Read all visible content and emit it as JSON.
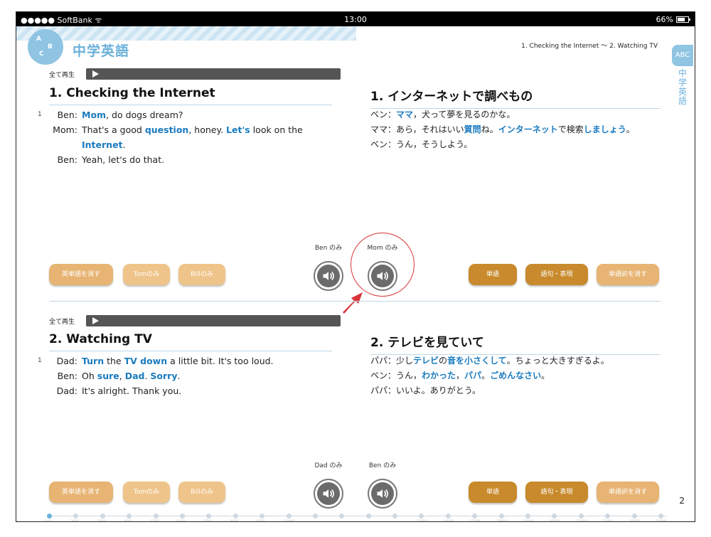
{
  "status_bar": {
    "carrier": "●●●●● SoftBank ᯤ",
    "time": "13:00",
    "battery": "66%"
  },
  "header": {
    "logo_letters": [
      "A",
      "B",
      "C"
    ],
    "title": "中学英語",
    "breadcrumb": "1. Checking the Internet ～ 2. Watching TV"
  },
  "side_tab": {
    "badge": "ABC",
    "label": "中学英語"
  },
  "playall_label": "全て再生",
  "sections": [
    {
      "en_title": "1. Checking the Internet",
      "jp_title": "1. インターネットで調べもの",
      "line_number": "1",
      "en_lines": [
        {
          "speaker": "Ben:",
          "parts": [
            {
              "t": "Mom",
              "h": true
            },
            {
              "t": ", do dogs dream?",
              "h": false
            }
          ]
        },
        {
          "speaker": "Mom:",
          "parts": [
            {
              "t": "That's a good ",
              "h": false
            },
            {
              "t": "question",
              "h": true
            },
            {
              "t": ", honey.  ",
              "h": false
            },
            {
              "t": "Let's",
              "h": true
            },
            {
              "t": " look on the ",
              "h": false
            },
            {
              "t": "Internet",
              "h": true
            },
            {
              "t": ".",
              "h": false
            }
          ]
        },
        {
          "speaker": "Ben:",
          "parts": [
            {
              "t": "Yeah, let's do that.",
              "h": false
            }
          ]
        }
      ],
      "jp_lines": [
        {
          "parts": [
            {
              "t": "ベン：",
              "h": false
            },
            {
              "t": "ママ",
              "h": true
            },
            {
              "t": "，犬って夢を見るのかな。",
              "h": false
            }
          ]
        },
        {
          "parts": [
            {
              "t": "ママ：あら，それはいい",
              "h": false
            },
            {
              "t": "質問",
              "h": true
            },
            {
              "t": "ね。",
              "h": false
            },
            {
              "t": "インターネット",
              "h": true
            },
            {
              "t": "で検索",
              "h": false
            },
            {
              "t": "しましょう",
              "h": true
            },
            {
              "t": "。",
              "h": false
            }
          ]
        },
        {
          "parts": [
            {
              "t": "ベン：うん，そうしよう。",
              "h": false
            }
          ]
        }
      ],
      "speaker_buttons": [
        "Ben のみ",
        "Mom のみ"
      ]
    },
    {
      "en_title": "2. Watching TV",
      "jp_title": "2. テレビを見ていて",
      "line_number": "1",
      "en_lines": [
        {
          "speaker": "Dad:",
          "parts": [
            {
              "t": "Turn",
              "h": true
            },
            {
              "t": " the ",
              "h": false
            },
            {
              "t": "TV down",
              "h": true
            },
            {
              "t": " a little bit.  It's too loud.",
              "h": false
            }
          ]
        },
        {
          "speaker": "Ben:",
          "parts": [
            {
              "t": "Oh ",
              "h": false
            },
            {
              "t": "sure",
              "h": true
            },
            {
              "t": ", ",
              "h": false
            },
            {
              "t": "Dad",
              "h": true
            },
            {
              "t": ".  ",
              "h": false
            },
            {
              "t": "Sorry",
              "h": true
            },
            {
              "t": ".",
              "h": false
            }
          ]
        },
        {
          "speaker": "Dad:",
          "parts": [
            {
              "t": "It's alright.  Thank you.",
              "h": false
            }
          ]
        }
      ],
      "jp_lines": [
        {
          "parts": [
            {
              "t": "パパ：少し",
              "h": false
            },
            {
              "t": "テレビ",
              "h": true
            },
            {
              "t": "の",
              "h": false
            },
            {
              "t": "音を小さくして",
              "h": true
            },
            {
              "t": "。ちょっと大きすぎるよ。",
              "h": false
            }
          ]
        },
        {
          "parts": [
            {
              "t": "ベン：うん，",
              "h": false
            },
            {
              "t": "わかった",
              "h": true
            },
            {
              "t": "，",
              "h": false
            },
            {
              "t": "パパ",
              "h": true
            },
            {
              "t": "。",
              "h": false
            },
            {
              "t": "ごめんなさい",
              "h": true
            },
            {
              "t": "。",
              "h": false
            }
          ]
        },
        {
          "parts": [
            {
              "t": "パパ：いいよ。ありがとう。",
              "h": false
            }
          ]
        }
      ],
      "speaker_buttons": [
        "Dad のみ",
        "Ben のみ"
      ]
    }
  ],
  "left_buttons": [
    "英単語を消す",
    "Tomのみ",
    "Billのみ"
  ],
  "right_buttons": [
    "単語",
    "語句・表現",
    "単語訳を消す"
  ],
  "page_number": "2",
  "timeline_ticks": [
    "100",
    "200",
    "300",
    "400",
    "500",
    "600",
    "700",
    "800",
    "900",
    "1000",
    "",
    "",
    "",
    "",
    "1500",
    "1600",
    "1700",
    "1800",
    "1900",
    "2000",
    "2100",
    "2200",
    "2300",
    "2400"
  ],
  "colors": {
    "highlight": "#1a7bbf",
    "accent_light": "#8fc4e3",
    "button_dark": "#c88a2c",
    "button_light": "#e7b473",
    "annotation_red": "#d9353a"
  }
}
